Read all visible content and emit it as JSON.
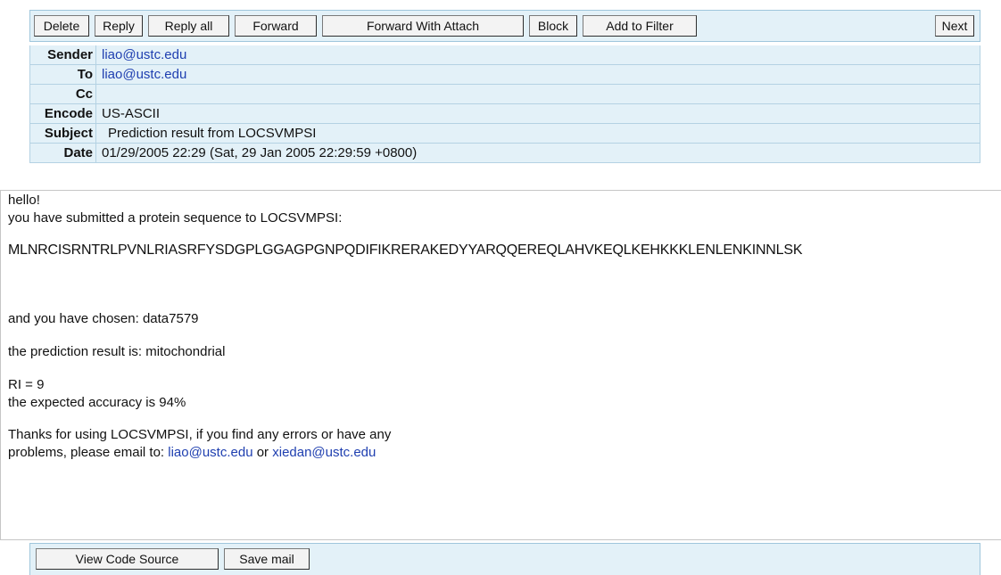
{
  "toolbar": {
    "delete": "Delete",
    "reply": "Reply",
    "reply_all": "Reply all",
    "forward": "Forward",
    "forward_attach": "Forward With Attach",
    "block": "Block",
    "add_filter": "Add to Filter",
    "next": "Next"
  },
  "headers": {
    "sender_label": "Sender",
    "sender_value": "liao@ustc.edu",
    "to_label": "To",
    "to_value": "liao@ustc.edu",
    "cc_label": "Cc",
    "cc_value": "",
    "encode_label": "Encode",
    "encode_value": "US-ASCII",
    "subject_label": "Subject",
    "subject_value": "Prediction result from LOCSVMPSI",
    "date_label": "Date",
    "date_value": "01/29/2005 22:29  (Sat, 29 Jan 2005 22:29:59 +0800)"
  },
  "body": {
    "greeting": "hello!",
    "submitted": "you have submitted a protein sequence to LOCSVMPSI:",
    "sequence": "MLNRCISRNTRLPVNLRIASRFYSDGPLGGAGPGNPQDIFIKRERAKEDYYARQQEREQLAHVKEQLKEHKKKLENLENKINNLSK",
    "chosen": "and you have chosen: data7579",
    "prediction": "the prediction result is: mitochondrial",
    "ri": "RI = 9",
    "accuracy": "the expected accuracy is 94%",
    "thanks_line1": "Thanks for using LOCSVMPSI, if you find any errors or have any",
    "thanks_line2_prefix": "problems, please email to: ",
    "email1": "liao@ustc.edu",
    "or_text": " or ",
    "email2": "xiedan@ustc.edu"
  },
  "bottom": {
    "view_source": "View Code Source",
    "save_mail": "Save mail"
  }
}
